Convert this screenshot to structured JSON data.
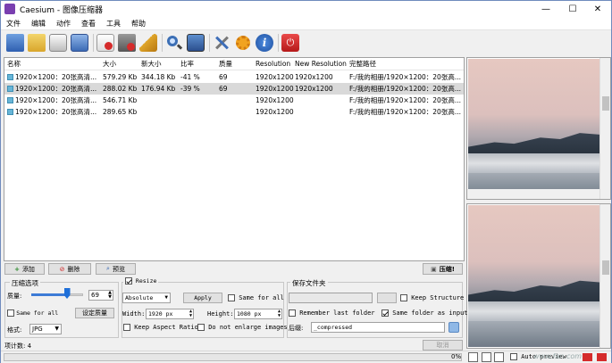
{
  "window": {
    "title": "Caesium - 图像压缩器"
  },
  "menu": [
    "文件",
    "编辑",
    "动作",
    "查看",
    "工具",
    "帮助"
  ],
  "toolbar": [
    "open-file-icon",
    "open-folder-icon",
    "save-icon",
    "save-as-icon",
    "remove-icon",
    "clear-icon",
    "clean-icon",
    "search-icon",
    "preview-icon",
    "settings-icon",
    "gear-icon",
    "info-icon",
    "exit-icon"
  ],
  "table": {
    "columns": [
      "名称",
      "大小",
      "新大小",
      "比率",
      "质量",
      "Resolution",
      "New Resolution",
      "完整路径"
    ],
    "rows": [
      {
        "name": "1920×1200：20张高清...",
        "size": "579.29 Kb",
        "new_size": "344.18 Kb",
        "ratio": "-41 %",
        "quality": "69",
        "resolution": "1920x1200",
        "new_resolution": "1920x1200",
        "path": "F:/我的相册/1920×1200：20张高..."
      },
      {
        "name": "1920×1200：20张高清...",
        "size": "288.02 Kb",
        "new_size": "176.94 Kb",
        "ratio": "-39 %",
        "quality": "69",
        "resolution": "1920x1200",
        "new_resolution": "1920x1200",
        "path": "F:/我的相册/1920×1200：20张高..."
      },
      {
        "name": "1920×1200：20张高清...",
        "size": "546.71 Kb",
        "new_size": "",
        "ratio": "",
        "quality": "",
        "resolution": "1920x1200",
        "new_resolution": "",
        "path": "F:/我的相册/1920×1200：20张高..."
      },
      {
        "name": "1920×1200：20张高清...",
        "size": "289.65 Kb",
        "new_size": "",
        "ratio": "",
        "quality": "",
        "resolution": "1920x1200",
        "new_resolution": "",
        "path": "F:/我的相册/1920×1200：20张高..."
      }
    ],
    "selected_row": 1
  },
  "buttons": {
    "add": "添加",
    "delete": "删除",
    "preview": "预览",
    "compress": "压缩!",
    "cancel": "取消",
    "apply": "Apply",
    "set_quality": "设定质量"
  },
  "compression": {
    "group": "压缩选项",
    "quality_label": "质量:",
    "quality_value": "69",
    "quality_fraction": 0.69,
    "same_for_all": "Same for all",
    "format_label": "格式:",
    "format_value": "JPG"
  },
  "resize": {
    "label": "Resize",
    "checked": true,
    "mode": "Absolute",
    "same_for_all": "Same for all",
    "width_label": "Width:",
    "width_value": "1920 px",
    "height_label": "Height:",
    "height_value": "1080 px",
    "keep_aspect": "Keep Aspect Ratio",
    "no_enlarge": "Do not enlarge images"
  },
  "output": {
    "group": "保存文件夹",
    "keep_structure": "Keep Structure",
    "remember_last": "Remember last folder",
    "same_folder": "Same folder as input",
    "suffix_label": "后缀:",
    "suffix_value": "_compressed"
  },
  "status": {
    "count_label": "项计数: 4",
    "progress": "0%",
    "auto_preview": "Auto preview",
    "watermark": "www.fan.com"
  }
}
